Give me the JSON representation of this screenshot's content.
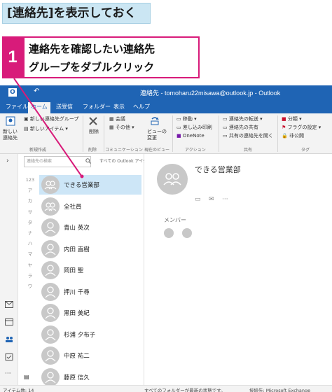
{
  "section_tag": "[連絡先]を表示しておく",
  "step": {
    "number": "1",
    "line1": "連絡先を確認したい連絡先",
    "line2": "グループをダブルクリック"
  },
  "window_title": "連絡先 - tomoharu22misawa@outlook.jp - Outlook",
  "tabs": [
    "ファイル",
    "ホーム",
    "送受信",
    "フォルダー",
    "表示",
    "ヘルプ"
  ],
  "active_tab": "ホーム",
  "ribbon": {
    "new_contact": "新しい\n連絡先",
    "new_group": "新しい連絡先グループ",
    "new_items": "新しいアイテム",
    "delete": "削除",
    "meeting": "会議",
    "other": "その他",
    "view": "ビューの\n変更",
    "move": "移動",
    "mail_merge": "差し込み印刷",
    "onenote": "OneNote",
    "forward": "連絡先の転送",
    "share": "連絡先の共有",
    "open_shared": "共有の連絡先を開く",
    "categorize": "分類",
    "follow_up": "フラグの設定",
    "private": "非公開",
    "groups": [
      "新規作成",
      "削除",
      "コミュニケーション",
      "現在のビュー",
      "アクション",
      "共有",
      "タグ"
    ]
  },
  "list": {
    "search_placeholder": "連絡先の検索",
    "scope": "すべての Outlook アイテム",
    "alpha": [
      "123",
      "ア",
      "カ",
      "サ",
      "タ",
      "ナ",
      "ハ",
      "マ",
      "ヤ",
      "ラ",
      "ワ"
    ],
    "contacts": [
      {
        "name": "できる営業部",
        "type": "group",
        "selected": true
      },
      {
        "name": "全社員",
        "type": "group",
        "selected": false
      },
      {
        "name": "青山 英次",
        "type": "person",
        "selected": false
      },
      {
        "name": "内田 直樹",
        "type": "person",
        "selected": false
      },
      {
        "name": "岡田 聖",
        "type": "person",
        "selected": false
      },
      {
        "name": "押川 千尋",
        "type": "person",
        "selected": false
      },
      {
        "name": "黒田 美紀",
        "type": "person",
        "selected": false
      },
      {
        "name": "杉浦 夕布子",
        "type": "person",
        "selected": false
      },
      {
        "name": "中原 祐二",
        "type": "person",
        "selected": false
      },
      {
        "name": "藤原 信久",
        "type": "person",
        "selected": false
      }
    ]
  },
  "reading": {
    "group_name": "できる営業部",
    "members_label": "メンバー"
  },
  "status": {
    "items": "アイテム数: 14",
    "folders": "すべてのフォルダーが最新の状態です。",
    "connected": "接続先: Microsoft Exchange"
  },
  "colors": {
    "accent_pink": "#d81b7a",
    "outlook_blue": "#1f64b4",
    "selection": "#cde6f7"
  }
}
